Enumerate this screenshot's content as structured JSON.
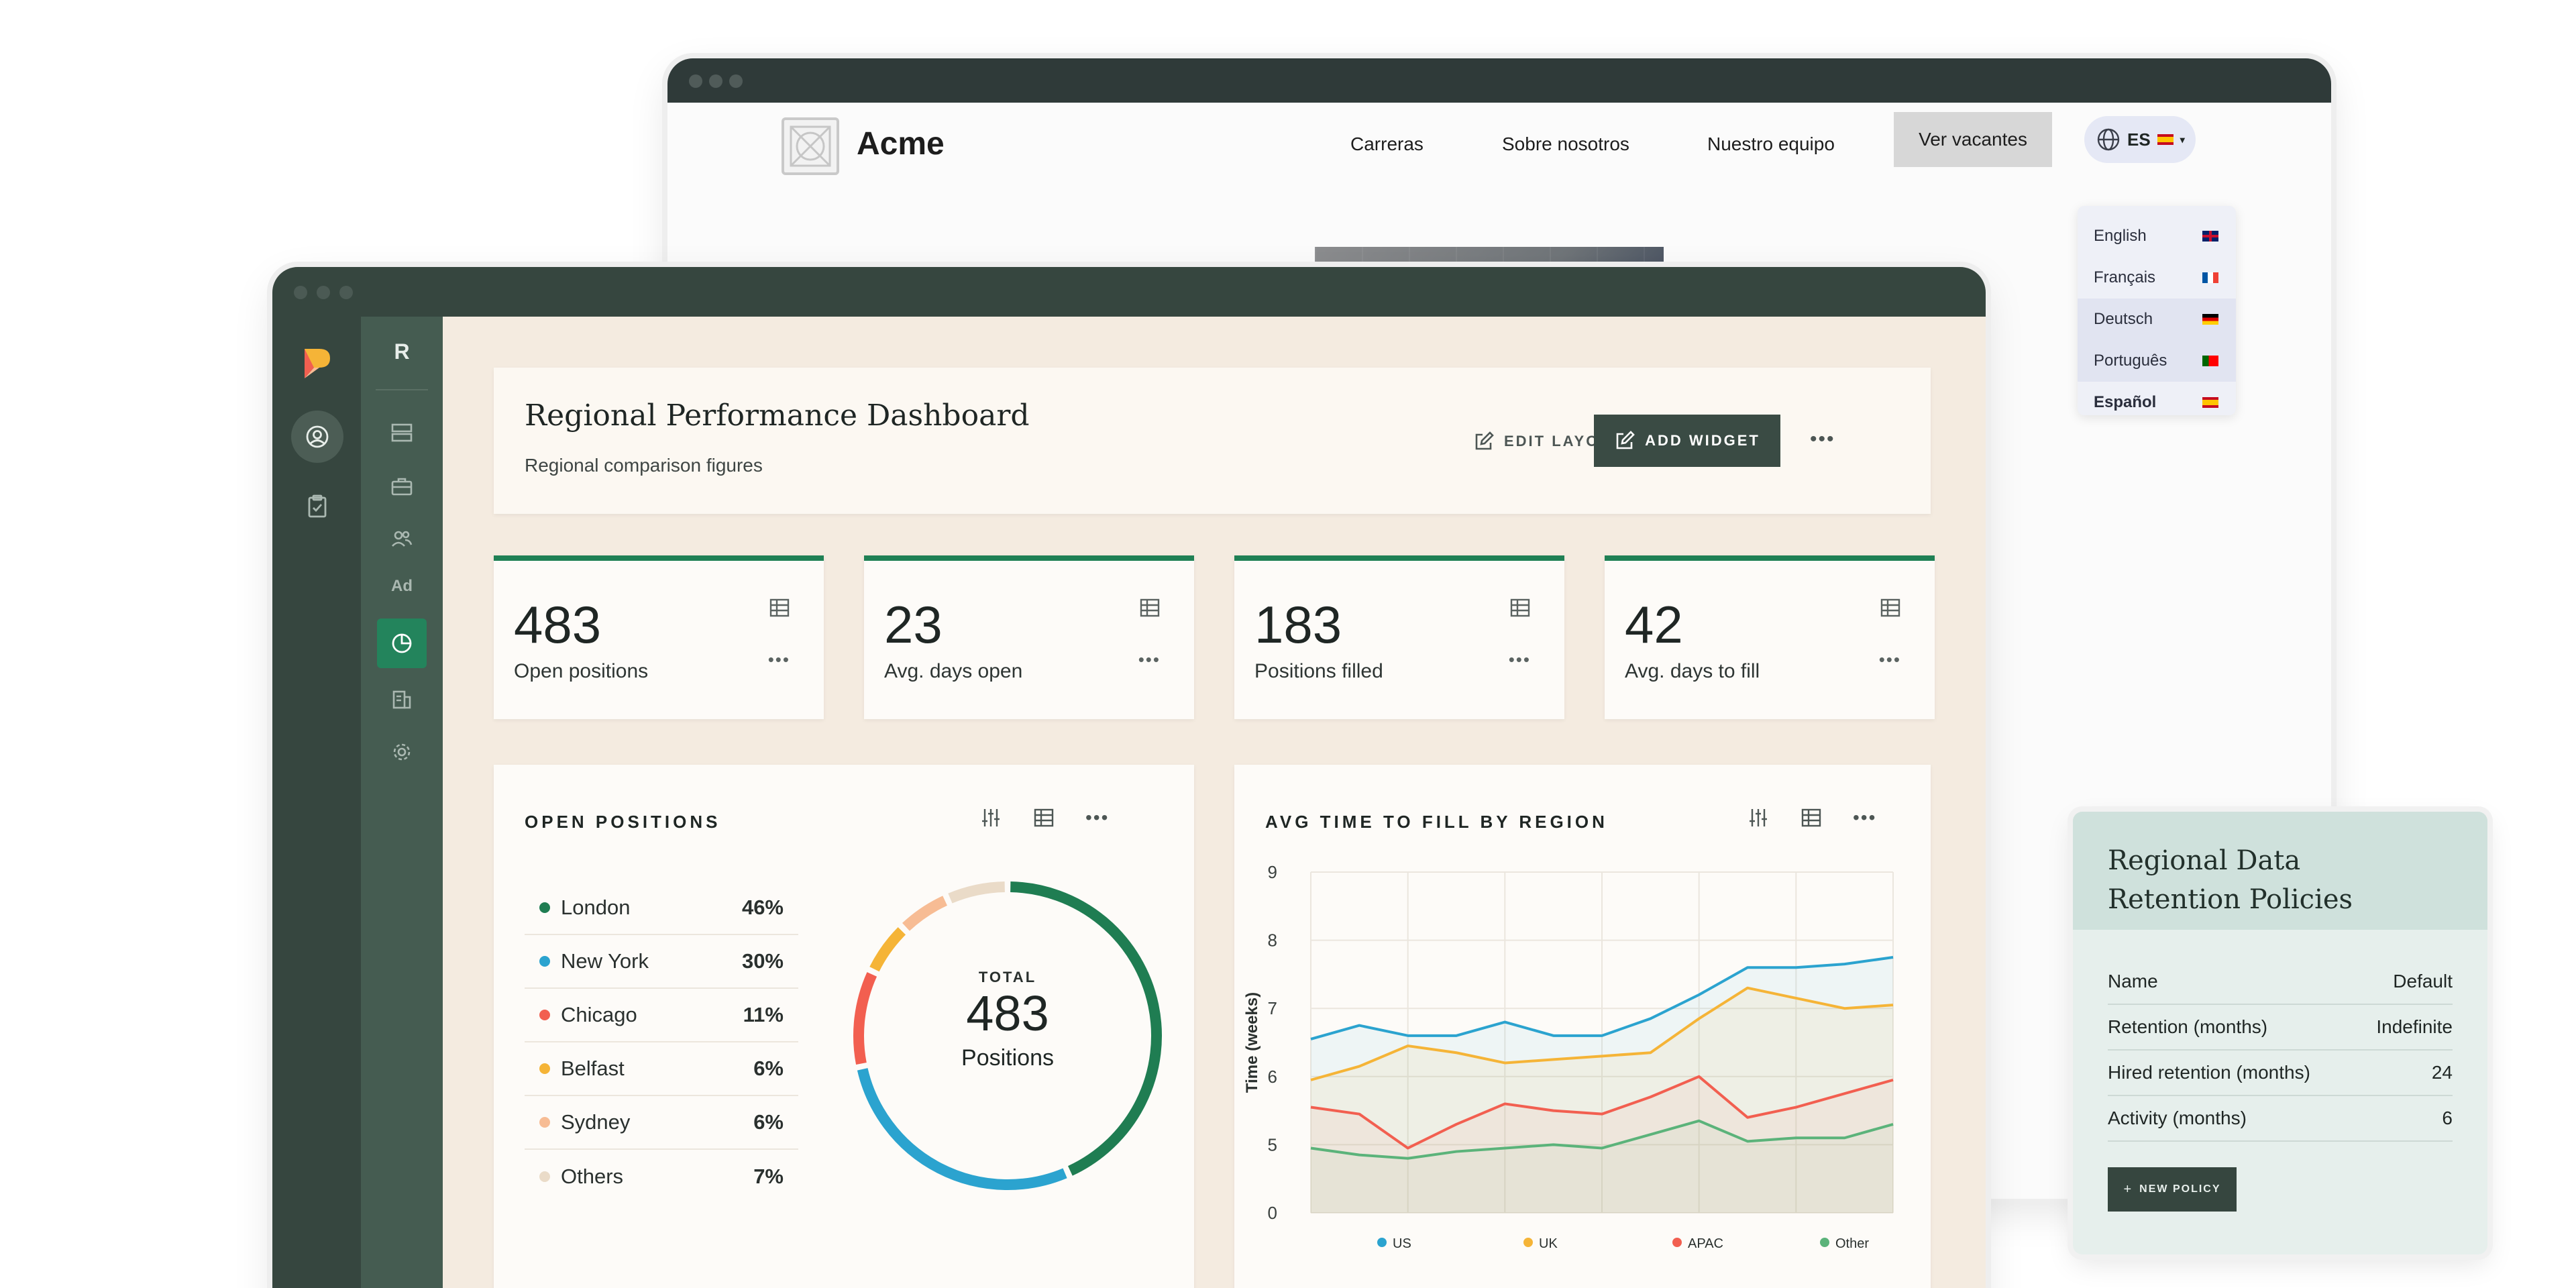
{
  "careers_site": {
    "logo_text": "Acme",
    "nav": [
      "Carreras",
      "Sobre nosotros",
      "Nuestro equipo"
    ],
    "cta": "Ver vacantes",
    "language": {
      "current": "ES",
      "options": [
        {
          "label": "English",
          "flag": "uk"
        },
        {
          "label": "Français",
          "flag": "fr"
        },
        {
          "label": "Deutsch",
          "flag": "de"
        },
        {
          "label": "Português",
          "flag": "pt"
        },
        {
          "label": "Español",
          "flag": "es"
        }
      ]
    }
  },
  "sidebar": {
    "workspace_initial": "R",
    "ad_label": "Ad"
  },
  "dashboard": {
    "title": "Regional Performance Dashboard",
    "subtitle": "Regional comparison figures",
    "edit_layout": "EDIT LAYOUT",
    "add_widget": "ADD WIDGET",
    "more": "•••",
    "kpis": [
      {
        "value": "483",
        "label": "Open positions"
      },
      {
        "value": "23",
        "label": "Avg. days open"
      },
      {
        "value": "183",
        "label": "Positions filled"
      },
      {
        "value": "42",
        "label": "Avg. days to fill"
      }
    ]
  },
  "open_positions": {
    "title": "OPEN POSITIONS",
    "total_label": "TOTAL",
    "total_value": "483",
    "total_unit": "Positions"
  },
  "avg_time": {
    "title": "AVG TIME TO FILL BY REGION"
  },
  "chart_data": [
    {
      "type": "pie",
      "title": "OPEN POSITIONS",
      "categories": [
        "London",
        "New York",
        "Chicago",
        "Belfast",
        "Sydney",
        "Others"
      ],
      "values": [
        46,
        30,
        11,
        6,
        6,
        7
      ],
      "labels": [
        "46%",
        "30%",
        "11%",
        "6%",
        "6%",
        "7%"
      ],
      "colors": [
        "#1f7d52",
        "#2ba3cf",
        "#f25f50",
        "#f5b437",
        "#f7bc94",
        "#eadbc8"
      ]
    },
    {
      "type": "line",
      "title": "AVG TIME TO FILL BY REGION",
      "ylabel": "Time (weeks)",
      "ylim": [
        4,
        9
      ],
      "yticks": [
        "0",
        "5",
        "6",
        "7",
        "8",
        "9"
      ],
      "x": [
        0,
        1,
        2,
        3,
        4,
        5,
        6,
        7,
        8,
        9,
        10,
        11,
        12
      ],
      "series": [
        {
          "name": "US",
          "color": "#2ba3cf",
          "values": [
            6.55,
            6.75,
            6.6,
            6.6,
            6.8,
            6.6,
            6.6,
            6.85,
            7.2,
            7.6,
            7.6,
            7.65,
            7.75
          ]
        },
        {
          "name": "UK",
          "color": "#f5b437",
          "values": [
            5.95,
            6.15,
            6.45,
            6.35,
            6.2,
            6.25,
            6.3,
            6.35,
            6.85,
            7.3,
            7.15,
            7.0,
            7.05
          ]
        },
        {
          "name": "APAC",
          "color": "#f25f50",
          "values": [
            5.55,
            5.45,
            4.95,
            5.3,
            5.6,
            5.5,
            5.45,
            5.7,
            6.0,
            5.4,
            5.55,
            5.75,
            5.95
          ]
        },
        {
          "name": "Other",
          "color": "#5bb37a",
          "values": [
            4.95,
            4.85,
            4.8,
            4.9,
            4.95,
            5.0,
            4.95,
            5.15,
            5.35,
            5.05,
            5.1,
            5.1,
            5.3
          ]
        }
      ],
      "grid": true,
      "legend": "bottom"
    }
  ],
  "policy": {
    "title_line1": "Regional Data",
    "title_line2": "Retention Policies",
    "rows": [
      {
        "label": "Name",
        "value": "Default"
      },
      {
        "label": "Retention (months)",
        "value": "Indefinite"
      },
      {
        "label": "Hired retention (months)",
        "value": "24"
      },
      {
        "label": "Activity (months)",
        "value": "6"
      }
    ],
    "new_policy": "NEW POLICY"
  }
}
